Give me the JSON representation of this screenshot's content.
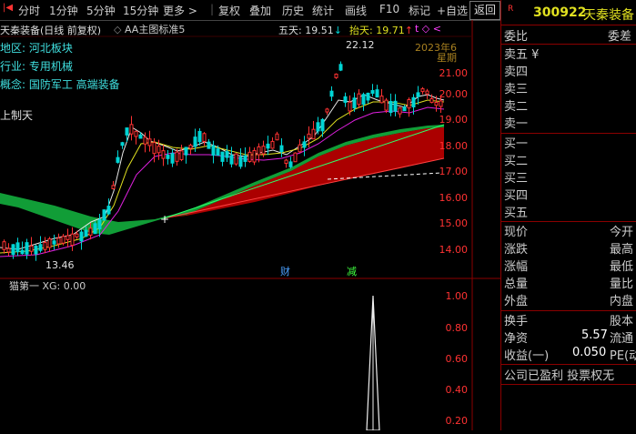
{
  "toolbar": {
    "tabs": [
      "分时",
      "1分钟",
      "5分钟",
      "15分钟",
      "更多 >"
    ],
    "buttons": [
      "复权",
      "叠加",
      "历史",
      "统计",
      "画线",
      "F10",
      "标记",
      "+自选"
    ],
    "back": "返回"
  },
  "header": {
    "title": "天秦装备(日线 前复权)",
    "indicator": "AA主图标准5",
    "wutian": "五天: 19.51",
    "wutian_arrow": "↓",
    "taitian": "抬天: 19.71",
    "taitian_arrow": "↑",
    "marks": "t ◇ <"
  },
  "info": {
    "region": "地区: 河北板块",
    "industry": "行业: 专用机械",
    "concept": "概念: 国防军工 高端装备",
    "upper": "上制天"
  },
  "chart": {
    "high_label": "22.12",
    "low_label": "13.46",
    "year_label": "2023年6",
    "weekday_label": "星期",
    "event_cai": "财",
    "event_jian": "减",
    "y_ticks": [
      "21.00",
      "20.00",
      "19.00",
      "18.00",
      "17.00",
      "16.00",
      "15.00",
      "14.00"
    ],
    "sub_label": "猫第一  XG: 0.00",
    "sub_ticks": [
      "1.00",
      "0.80",
      "0.60",
      "0.40",
      "0.20"
    ],
    "colors": {
      "up": "#ff3232",
      "down": "#00d4d4",
      "cloud_green": "#12a53a",
      "cloud_red": "#b40000"
    }
  },
  "panel": {
    "code": "300922",
    "name": "天秦装备",
    "r_badge": "R",
    "weibi": "委比",
    "weicha": "委差",
    "sells": [
      "卖五 ¥",
      "卖四",
      "卖三",
      "卖二",
      "卖一"
    ],
    "buys": [
      "买一",
      "买二",
      "买三",
      "买四",
      "买五"
    ],
    "stats": [
      {
        "l": "现价",
        "r": "今开"
      },
      {
        "l": "涨跌",
        "r": "最高"
      },
      {
        "l": "涨幅",
        "r": "最低"
      },
      {
        "l": "总量",
        "r": "量比"
      },
      {
        "l": "外盘",
        "r": "内盘"
      }
    ],
    "stats2": [
      {
        "l": "换手",
        "v": "",
        "r": "股本"
      },
      {
        "l": "净资",
        "v": "5.57",
        "r": "流通"
      },
      {
        "l": "收益(一)",
        "v": "0.050",
        "r": "PE(动"
      }
    ],
    "footer": "公司已盈利 投票权无"
  }
}
